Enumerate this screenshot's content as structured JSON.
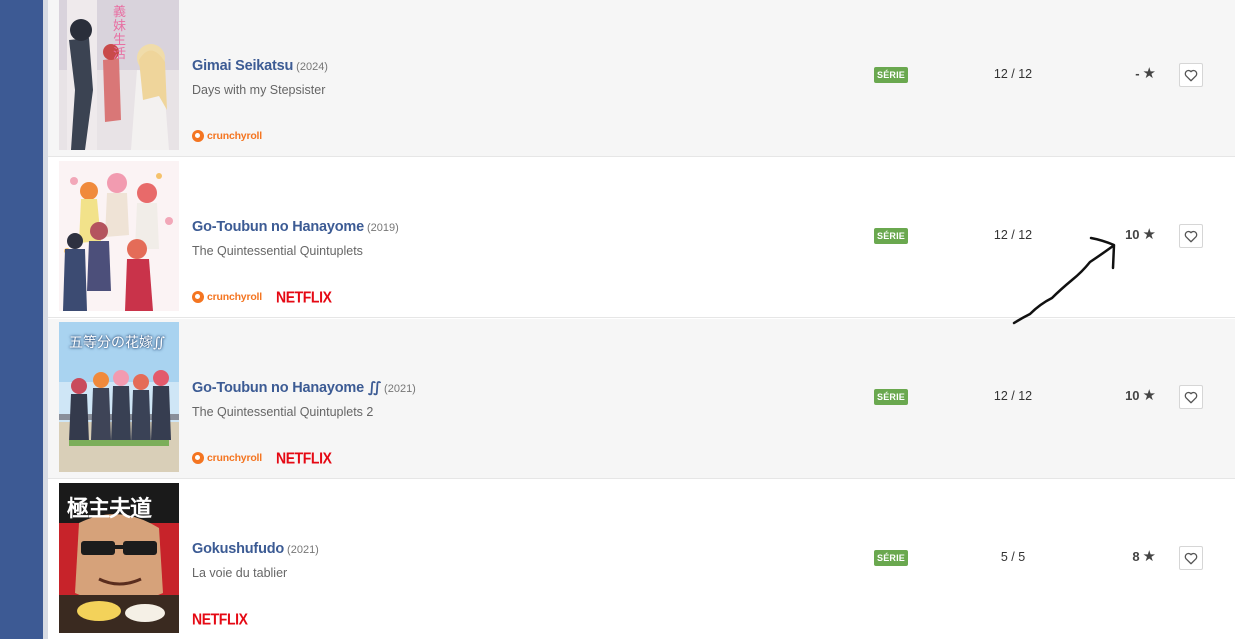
{
  "colors": {
    "sidebar": "#3d5a94",
    "title_link": "#3c5b94",
    "badge": "#6aa84f",
    "crunchyroll": "#f47521",
    "netflix": "#e50914"
  },
  "rows": [
    {
      "title": "Gimai Seikatsu",
      "year": "(2024)",
      "subtitle": "Days with my Stepsister",
      "platforms": {
        "crunchyroll": "crunchyroll",
        "netflix": ""
      },
      "type_badge": "SÉRIE",
      "episodes": "12 / 12",
      "rating": "-",
      "rating_icon": "star-icon",
      "favorite_icon": "heart-icon"
    },
    {
      "title": "Go-Toubun no Hanayome",
      "year": "(2019)",
      "subtitle": "The Quintessential Quintuplets",
      "platforms": {
        "crunchyroll": "crunchyroll",
        "netflix": "NETFLIX"
      },
      "type_badge": "SÉRIE",
      "episodes": "12 / 12",
      "rating": "10",
      "rating_icon": "star-icon",
      "favorite_icon": "heart-icon"
    },
    {
      "title": "Go-Toubun no Hanayome ∬",
      "year": "(2021)",
      "subtitle": "The Quintessential Quintuplets 2",
      "platforms": {
        "crunchyroll": "crunchyroll",
        "netflix": "NETFLIX"
      },
      "type_badge": "SÉRIE",
      "episodes": "12 / 12",
      "rating": "10",
      "rating_icon": "star-icon",
      "favorite_icon": "heart-icon"
    },
    {
      "title": "Gokushufudo",
      "year": "(2021)",
      "subtitle": "La voie du tablier",
      "platforms": {
        "crunchyroll": "",
        "netflix": "NETFLIX"
      },
      "type_badge": "SÉRIE",
      "episodes": "5 / 5",
      "rating": "8",
      "rating_icon": "star-icon",
      "favorite_icon": "heart-icon"
    }
  ],
  "posters": [
    {
      "kanji": "義妹生活"
    },
    {
      "kanji": ""
    },
    {
      "kanji": "五等分の花嫁∬"
    },
    {
      "kanji": "極主夫道"
    }
  ]
}
